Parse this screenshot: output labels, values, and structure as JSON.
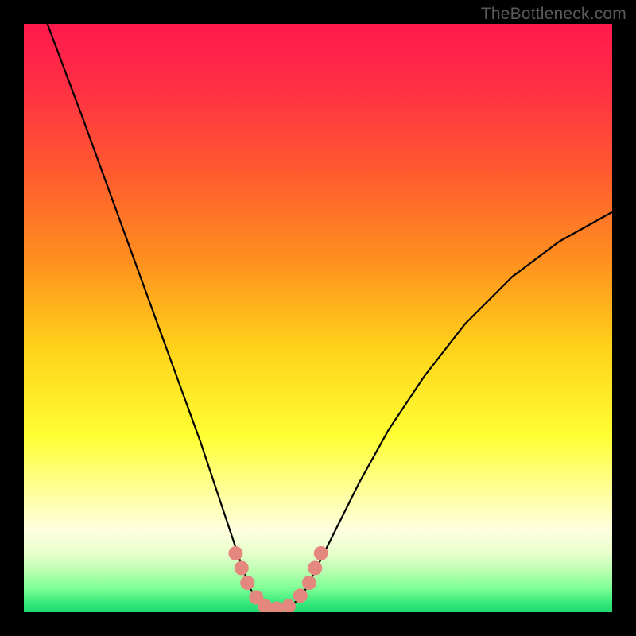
{
  "watermark": "TheBottleneck.com",
  "gradient_stops": [
    {
      "offset": 0.0,
      "color": "#ff1a4d"
    },
    {
      "offset": 0.1,
      "color": "#ff2d45"
    },
    {
      "offset": 0.25,
      "color": "#ff5a2f"
    },
    {
      "offset": 0.4,
      "color": "#ff8f1f"
    },
    {
      "offset": 0.55,
      "color": "#ffd21a"
    },
    {
      "offset": 0.7,
      "color": "#ffff33"
    },
    {
      "offset": 0.8,
      "color": "#ffffa0"
    },
    {
      "offset": 0.86,
      "color": "#ffffe0"
    },
    {
      "offset": 0.9,
      "color": "#e8ffcc"
    },
    {
      "offset": 0.93,
      "color": "#b9ffb0"
    },
    {
      "offset": 0.96,
      "color": "#7dff96"
    },
    {
      "offset": 0.985,
      "color": "#35e87a"
    },
    {
      "offset": 1.0,
      "color": "#1fd86e"
    }
  ],
  "chart_data": {
    "type": "line",
    "title": "",
    "xlabel": "",
    "ylabel": "",
    "xlim": [
      0,
      100
    ],
    "ylim": [
      0,
      100
    ],
    "grid": false,
    "curve": [
      {
        "x": 4,
        "y": 100
      },
      {
        "x": 7,
        "y": 92
      },
      {
        "x": 10,
        "y": 84
      },
      {
        "x": 14,
        "y": 73
      },
      {
        "x": 18,
        "y": 62
      },
      {
        "x": 22,
        "y": 51
      },
      {
        "x": 26,
        "y": 40
      },
      {
        "x": 30,
        "y": 29
      },
      {
        "x": 33,
        "y": 20
      },
      {
        "x": 35,
        "y": 14
      },
      {
        "x": 37,
        "y": 8
      },
      {
        "x": 38.5,
        "y": 4
      },
      {
        "x": 40,
        "y": 1.5
      },
      {
        "x": 42,
        "y": 0.5
      },
      {
        "x": 44,
        "y": 0.5
      },
      {
        "x": 46,
        "y": 1.5
      },
      {
        "x": 48,
        "y": 4
      },
      {
        "x": 50,
        "y": 8
      },
      {
        "x": 53,
        "y": 14
      },
      {
        "x": 57,
        "y": 22
      },
      {
        "x": 62,
        "y": 31
      },
      {
        "x": 68,
        "y": 40
      },
      {
        "x": 75,
        "y": 49
      },
      {
        "x": 83,
        "y": 57
      },
      {
        "x": 91,
        "y": 63
      },
      {
        "x": 100,
        "y": 68
      }
    ],
    "markers": [
      {
        "x": 36,
        "y": 10
      },
      {
        "x": 37,
        "y": 7.5
      },
      {
        "x": 38,
        "y": 5
      },
      {
        "x": 39.5,
        "y": 2.5
      },
      {
        "x": 41,
        "y": 1
      },
      {
        "x": 43,
        "y": 0.6
      },
      {
        "x": 45,
        "y": 1
      },
      {
        "x": 47,
        "y": 2.8
      },
      {
        "x": 48.5,
        "y": 5
      },
      {
        "x": 49.5,
        "y": 7.5
      },
      {
        "x": 50.5,
        "y": 10
      }
    ]
  },
  "colors": {
    "curve_stroke": "#000000",
    "marker_fill": "#e4877f",
    "marker_radius_px": 9
  }
}
